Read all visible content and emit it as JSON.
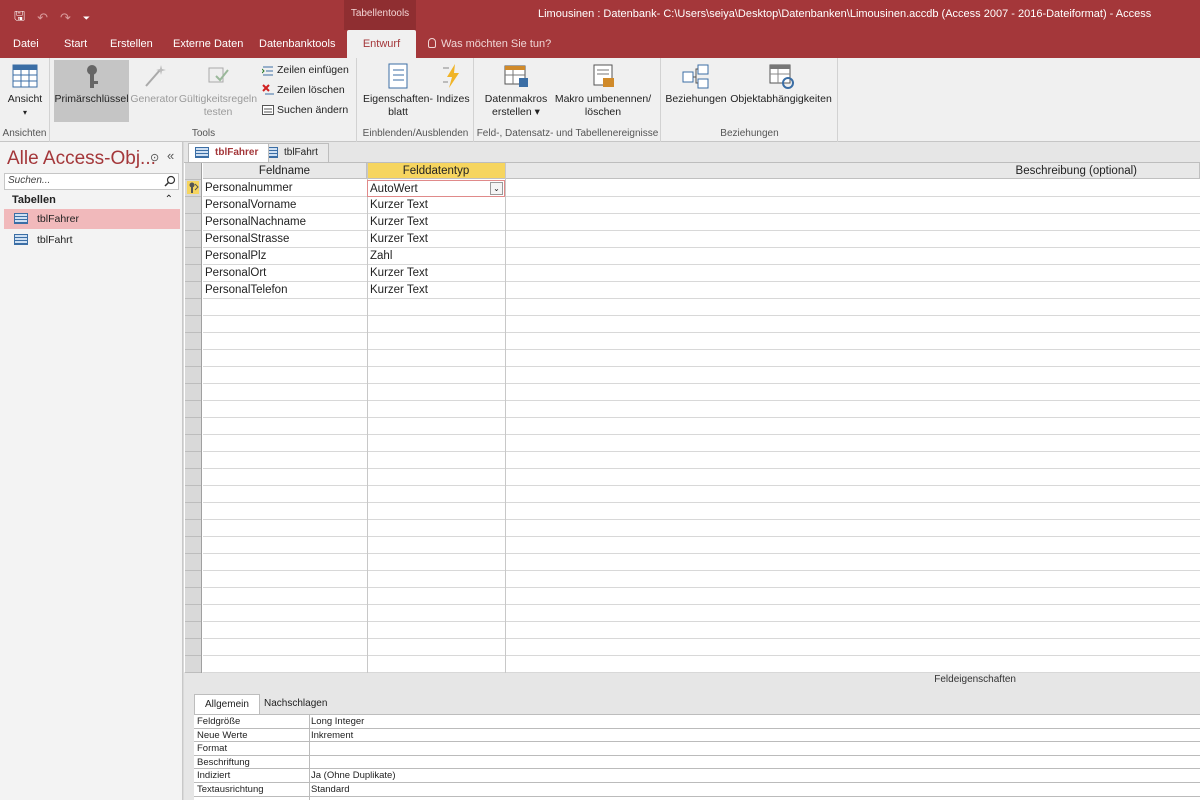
{
  "titlebar": {
    "context_tab": "Tabellentools",
    "window_title": "Limousinen : Datenbank- C:\\Users\\seiya\\Desktop\\Datenbanken\\Limousinen.accdb (Access 2007 - 2016-Dateiformat)  -  Access",
    "qa_save": "🖫",
    "qa_undo": "↶",
    "qa_redo": "↷",
    "qa_more": "⏷"
  },
  "ribbon_tabs": [
    "Datei",
    "Start",
    "Erstellen",
    "Externe Daten",
    "Datenbanktools",
    "Entwurf"
  ],
  "tell_me": "Was möchten Sie tun?",
  "ribbon": {
    "ansicht": "Ansicht",
    "ansicht_arrow": "▾",
    "primaerschluessel": "Primärschlüssel",
    "generator": "Generator",
    "gueltigkeit_1": "Gültigkeitsregeln",
    "gueltigkeit_2": "testen",
    "zeilen_einfuegen": "Zeilen einfügen",
    "zeilen_loeschen": "Zeilen löschen",
    "suchen_aendern": "Suchen ändern",
    "eigenschaften_1": "Eigenschaften-",
    "eigenschaften_2": "blatt",
    "indizes": "Indizes",
    "datenmakros_1": "Datenmakros",
    "datenmakros_2": "erstellen ▾",
    "makro_1": "Makro umbenennen/",
    "makro_2": "löschen",
    "beziehungen": "Beziehungen",
    "objektabh": "Objektabhängigkeiten",
    "groups": {
      "ansichten": "Ansichten",
      "tools": "Tools",
      "einblenden": "Einblenden/Ausblenden",
      "ereignisse": "Feld-, Datensatz- und Tabellenereignisse",
      "beziehungen": "Beziehungen"
    }
  },
  "nav": {
    "title": "Alle Access-Obj...",
    "menu_glyph": "⊙",
    "collapse_glyph": "«",
    "search_placeholder": "Suchen...",
    "section": "Tabellen",
    "section_glyph": "⌃",
    "items": [
      "tblFahrer",
      "tblFahrt"
    ]
  },
  "doc_tabs": [
    "tblFahrer",
    "tblFahrt"
  ],
  "design_grid": {
    "headers": [
      "Feldname",
      "Felddatentyp",
      "Beschreibung (optional)"
    ],
    "rows": [
      {
        "name": "Personalnummer",
        "type": "AutoWert"
      },
      {
        "name": "PersonalVorname",
        "type": "Kurzer Text"
      },
      {
        "name": "PersonalNachname",
        "type": "Kurzer Text"
      },
      {
        "name": "PersonalStrasse",
        "type": "Kurzer Text"
      },
      {
        "name": "PersonalPlz",
        "type": "Zahl"
      },
      {
        "name": "PersonalOrt",
        "type": "Kurzer Text"
      },
      {
        "name": "PersonalTelefon",
        "type": "Kurzer Text"
      }
    ],
    "dropdown_glyph": "⌄"
  },
  "field_props": {
    "title": "Feldeigenschaften",
    "tabs": [
      "Allgemein",
      "Nachschlagen"
    ],
    "rows": [
      {
        "label": "Feldgröße",
        "value": "Long Integer"
      },
      {
        "label": "Neue Werte",
        "value": "Inkrement"
      },
      {
        "label": "Format",
        "value": ""
      },
      {
        "label": "Beschriftung",
        "value": ""
      },
      {
        "label": "Indiziert",
        "value": "Ja (Ohne Duplikate)"
      },
      {
        "label": "Textausrichtung",
        "value": "Standard"
      }
    ]
  },
  "colors": {
    "accent": "#a4373a",
    "selected_nav": "#f1b9bb",
    "header_highlight": "#f6d55f"
  }
}
